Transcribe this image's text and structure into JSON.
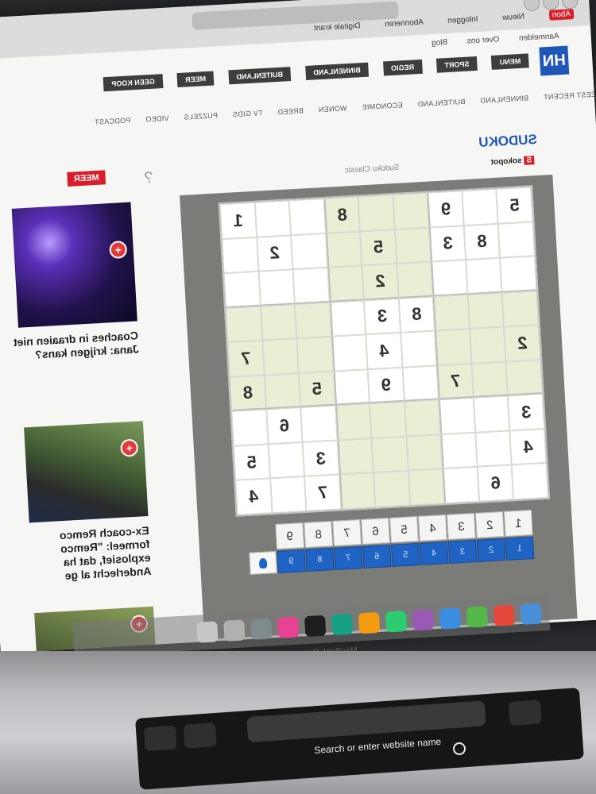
{
  "browser": {
    "bookmarks": [
      "Nieuw",
      "Inloggen",
      "Abonneren",
      "Digitale krant"
    ],
    "bookmark_highlight": "Abon"
  },
  "site": {
    "util_links": [
      "Aanmelden",
      "Over ons",
      "Blog"
    ],
    "logo_text": "HN",
    "main_nav": [
      "MENU",
      "SPORT",
      "REGIO",
      "BINNENLAND",
      "BUITENLAND",
      "MEER",
      "GEEN KOOP"
    ],
    "sub_nav": [
      "MEEST RECENT",
      "BINNENLAND",
      "BUITENLAND",
      "ECONOMIE",
      "WONEN",
      "BREED",
      "TV GIDS",
      "PUZZELS",
      "VIDEO",
      "PODCAST"
    ]
  },
  "sudoku": {
    "title": "SUDOKU",
    "sponsor_label": "sokopot",
    "variant": "Sudoku Classic",
    "help": "?",
    "side_badge": "MEER",
    "grid": [
      [
        "5",
        "",
        "9",
        "",
        "",
        "8",
        "",
        "",
        "1"
      ],
      [
        "",
        "8",
        "3",
        "",
        "5",
        "",
        "",
        "2",
        ""
      ],
      [
        "",
        "",
        "",
        "",
        "2",
        "",
        "",
        "",
        ""
      ],
      [
        "",
        "",
        "",
        "8",
        "3",
        "",
        "",
        "",
        ""
      ],
      [
        "2",
        "",
        "",
        "",
        "4",
        "",
        "",
        "",
        "7"
      ],
      [
        "",
        "",
        "7",
        "",
        "9",
        "",
        "5",
        "",
        "8"
      ],
      [
        "3",
        "",
        "",
        "",
        "",
        "",
        "",
        "6",
        ""
      ],
      [
        "4",
        "",
        "",
        "",
        "",
        "",
        "3",
        "",
        "5"
      ],
      [
        "",
        "6",
        "",
        "",
        "",
        "",
        "7",
        "",
        "4"
      ]
    ],
    "number_buttons": [
      "1",
      "2",
      "3",
      "4",
      "5",
      "6",
      "7",
      "8",
      "9"
    ],
    "note_buttons": [
      "1",
      "2",
      "3",
      "4",
      "5",
      "6",
      "7",
      "8",
      "9"
    ]
  },
  "sidebar": {
    "headlines": [
      "Coaches in draaien niet Jana: krijgen kans?",
      "Ex-coach Remco formeel: \"Remco explosief, dat ha Anderlecht al ge"
    ]
  },
  "laptop": {
    "model": "MacBook Pro",
    "touchbar_search": "Search or enter website name"
  },
  "colors": {
    "accent": "#1f57b8",
    "red": "#d81e2a",
    "board_shade": "#e9eed4"
  }
}
